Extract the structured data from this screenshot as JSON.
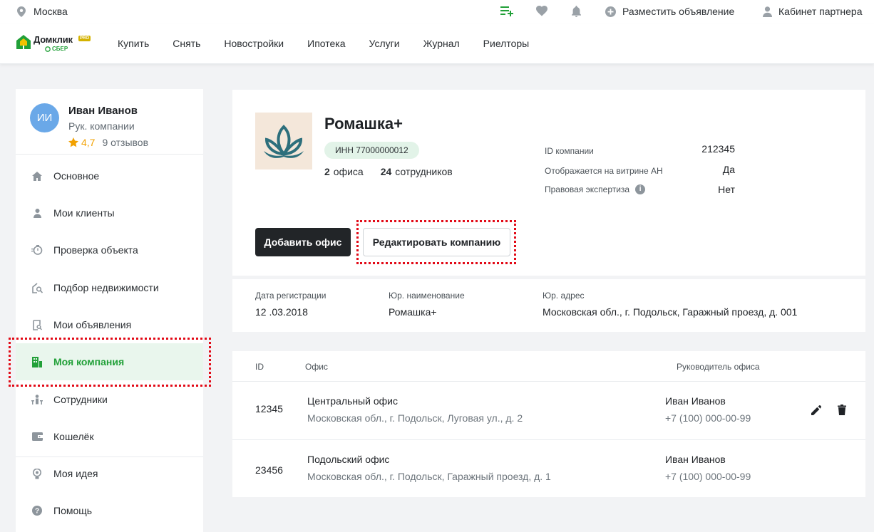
{
  "topbar": {
    "city": "Москва",
    "post_ad": "Разместить объявление",
    "partner_cabinet": "Кабинет партнера"
  },
  "logo": {
    "name": "Домклик",
    "badge": "PRO",
    "sub": "СБЕР"
  },
  "nav": [
    "Купить",
    "Снять",
    "Новостройки",
    "Ипотека",
    "Услуги",
    "Журнал",
    "Риелторы"
  ],
  "profile": {
    "initials": "ИИ",
    "name": "Иван Иванов",
    "role": "Рук. компании",
    "rating": "4,7",
    "reviews": "9 отзывов"
  },
  "menu": [
    {
      "label": "Основное",
      "icon": "home-icon"
    },
    {
      "label": "Мои клиенты",
      "icon": "person-icon"
    },
    {
      "label": "Проверка объекта",
      "icon": "timer-icon"
    },
    {
      "label": "Подбор недвижимости",
      "icon": "house-search-icon"
    },
    {
      "label": "Мои объявления",
      "icon": "document-search-icon"
    },
    {
      "label": "Моя компания",
      "icon": "building-icon"
    },
    {
      "label": "Сотрудники",
      "icon": "team-icon"
    },
    {
      "label": "Кошелёк",
      "icon": "wallet-icon"
    },
    {
      "label": "Моя идея",
      "icon": "lightbulb-icon"
    },
    {
      "label": "Помощь",
      "icon": "help-icon"
    }
  ],
  "company": {
    "name": "Ромашка+",
    "inn": "ИНН 77000000012",
    "offices_count": "2",
    "offices_word": "офиса",
    "employees_count": "24",
    "employees_word": "сотрудников",
    "props": [
      {
        "label": "ID компании",
        "value": "212345"
      },
      {
        "label": "Отображается на витрине АН",
        "value": "Да"
      },
      {
        "label": "Правовая экспертиза",
        "value": "Нет"
      }
    ],
    "add_office": "Добавить офис",
    "edit_company": "Редактировать компанию"
  },
  "registration": {
    "date_label": "Дата регистрации",
    "date_value": "12 .03.2018",
    "legal_name_label": "Юр. наименование",
    "legal_name_value": "Ромашка+",
    "legal_address_label": "Юр. адрес",
    "legal_address_value": "Московская обл., г. Подольск, Гаражный проезд, д. 001"
  },
  "offices_table": {
    "headers": {
      "id": "ID",
      "office": "Офис",
      "head": "Руководитель офиса"
    },
    "rows": [
      {
        "id": "12345",
        "name": "Центральный офис",
        "address": "Московская обл., г. Подольск, Луговая ул.,  д. 2",
        "head_name": "Иван Иванов",
        "head_phone": "+7 (100) 000-00-99"
      },
      {
        "id": "23456",
        "name": "Подольский офис",
        "address": "Московская обл., г. Подольск, Гаражный проезд,  д. 1",
        "head_name": "Иван Иванов",
        "head_phone": "+7 (100) 000-00-99"
      }
    ]
  },
  "colors": {
    "accent": "#21a038",
    "highlight": "#e20a17",
    "dark_button": "#222528"
  }
}
